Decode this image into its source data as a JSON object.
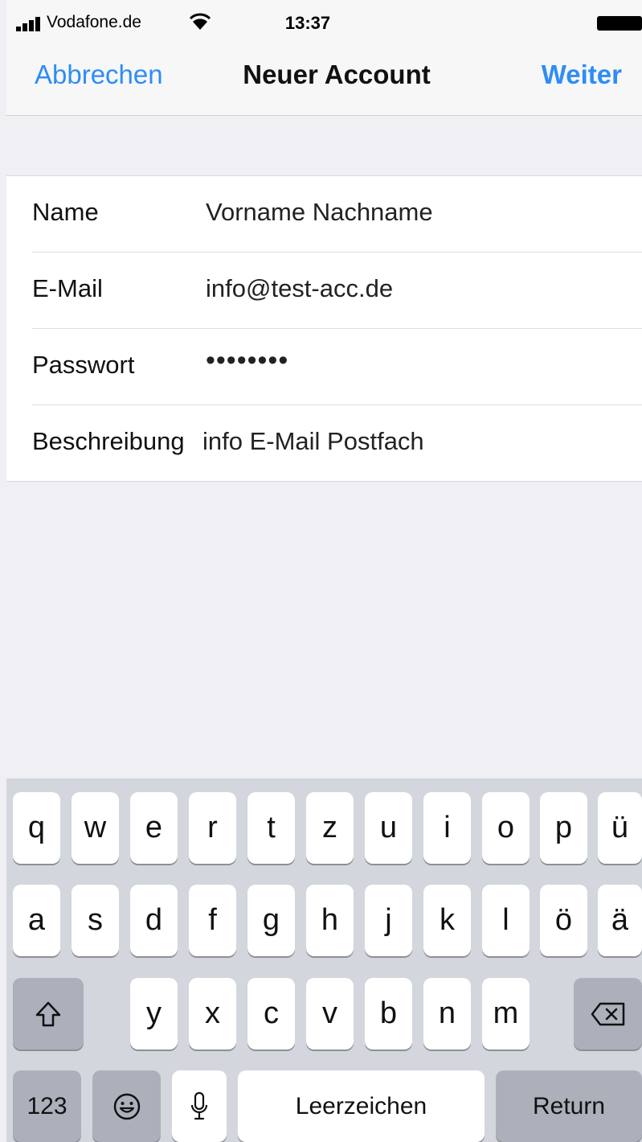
{
  "status_bar": {
    "carrier": "Vodafone.de",
    "time": "13:37"
  },
  "nav": {
    "cancel": "Abbrechen",
    "title": "Neuer Account",
    "next": "Weiter"
  },
  "form": {
    "rows": [
      {
        "label": "Name",
        "value": "Vorname Nachname"
      },
      {
        "label": "E-Mail",
        "value": "info@test-acc.de"
      },
      {
        "label": "Passwort",
        "value": "••••••••"
      },
      {
        "label": "Beschreibung",
        "value": "info E-Mail Postfach"
      }
    ]
  },
  "keyboard": {
    "row1": [
      "q",
      "w",
      "e",
      "r",
      "t",
      "z",
      "u",
      "i",
      "o",
      "p",
      "ü"
    ],
    "row2": [
      "a",
      "s",
      "d",
      "f",
      "g",
      "h",
      "j",
      "k",
      "l",
      "ö",
      "ä"
    ],
    "row3": [
      "y",
      "x",
      "c",
      "v",
      "b",
      "n",
      "m"
    ],
    "numbers": "123",
    "space": "Leerzeichen",
    "return": "Return",
    "icons": {
      "shift": "shift-icon",
      "backspace": "backspace-icon",
      "emoji": "emoji-icon",
      "mic": "microphone-icon"
    }
  },
  "colors": {
    "accent": "#2f8cf6",
    "background": "#efeff4",
    "keyboard_bg": "#d3d6dc",
    "key_dark": "#abb0ba"
  }
}
